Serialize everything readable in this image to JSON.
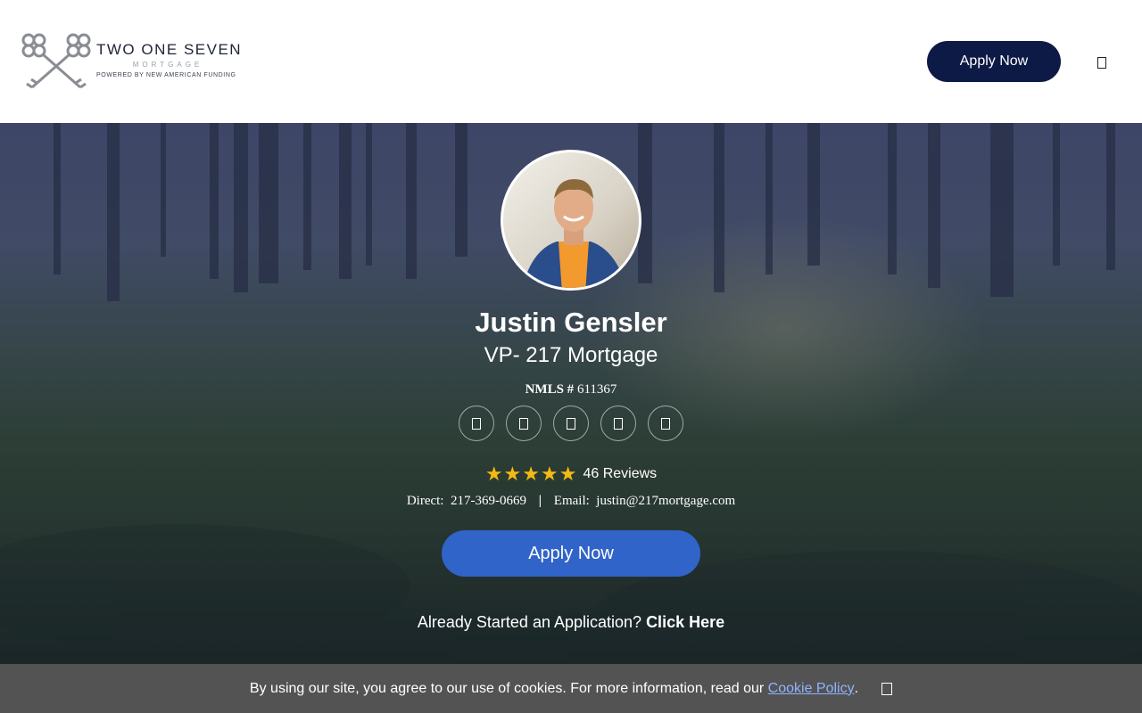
{
  "header": {
    "logo": {
      "title": "TWO ONE SEVEN",
      "subtitle": "MORTGAGE",
      "powered_by": "POWERED BY NEW AMERICAN FUNDING"
    },
    "apply_label": "Apply Now",
    "menu_icon": "menu-icon"
  },
  "hero": {
    "name": "Justin Gensler",
    "title": "VP- 217 Mortgage",
    "nmls_label": "NMLS #",
    "nmls_number": "611367",
    "social_icons": [
      "facebook-icon",
      "linkedin-icon",
      "instagram-icon",
      "twitter-icon",
      "youtube-icon"
    ],
    "rating": {
      "stars": 5,
      "stars_text": "★★★★★",
      "reviews_text": "46 Reviews"
    },
    "contact": {
      "direct_label": "Direct:",
      "phone": "217-369-0669",
      "separator": "|",
      "email_label": "Email:",
      "email": "justin@217mortgage.com"
    },
    "apply_label": "Apply Now",
    "already_text": "Already Started an Application?",
    "click_here": "Click Here"
  },
  "cookie_banner": {
    "text": "By using our site, you agree to our use of cookies. For more information, read our",
    "link_text": "Cookie Policy",
    "period": "."
  },
  "colors": {
    "header_button": "#0d1a45",
    "hero_button": "#3164c8",
    "stars": "#f5b913",
    "cookie_link": "#8fb3ff"
  }
}
